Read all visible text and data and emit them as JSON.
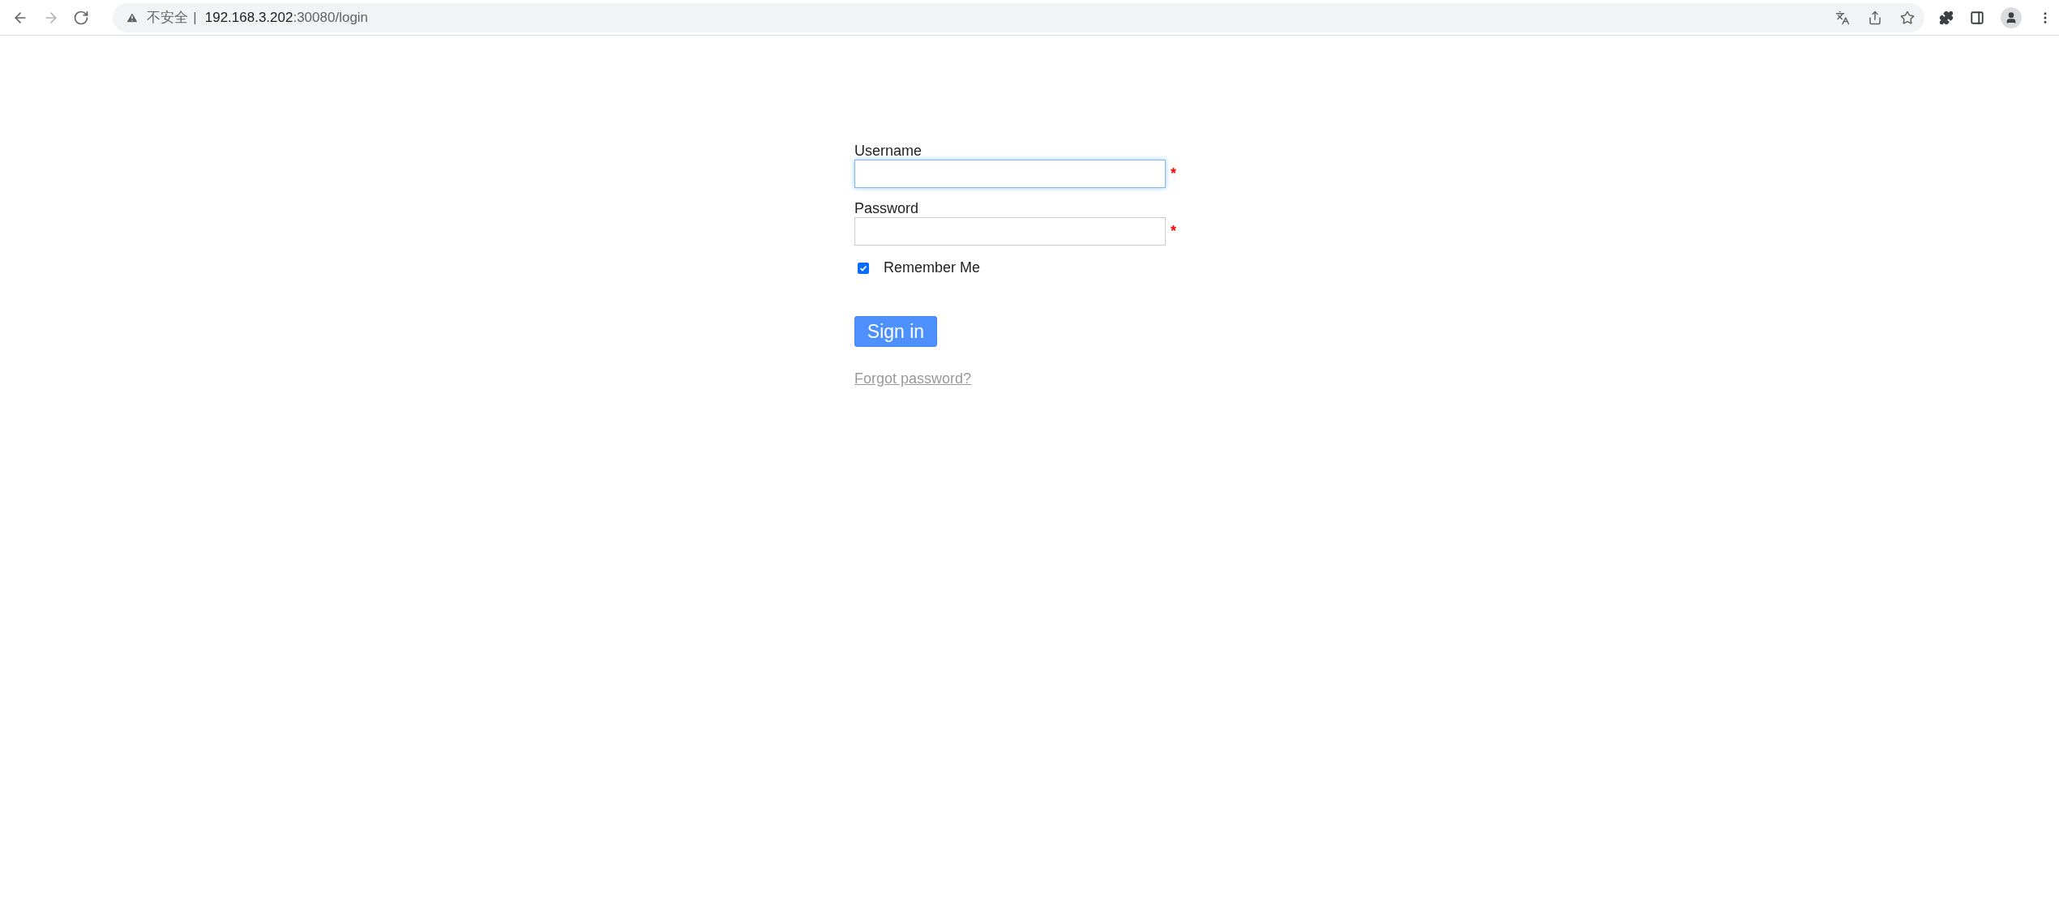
{
  "browser": {
    "nav_buttons": [
      {
        "kind": "back",
        "disabled": false
      },
      {
        "kind": "forward",
        "disabled": true
      },
      {
        "kind": "reload",
        "disabled": false
      }
    ],
    "security_label": "不安全",
    "separator": "|",
    "url_host": "192.168.3.202",
    "url_path": ":30080/login"
  },
  "form": {
    "fields": [
      {
        "label": "Username",
        "focused": true,
        "required": true,
        "required_mark": "*"
      },
      {
        "label": "Password",
        "focused": false,
        "required": true,
        "required_mark": "*"
      }
    ],
    "remember": {
      "label": "Remember Me",
      "checked": true
    },
    "submit": "Sign in",
    "forgot_link": "Forgot password?"
  }
}
